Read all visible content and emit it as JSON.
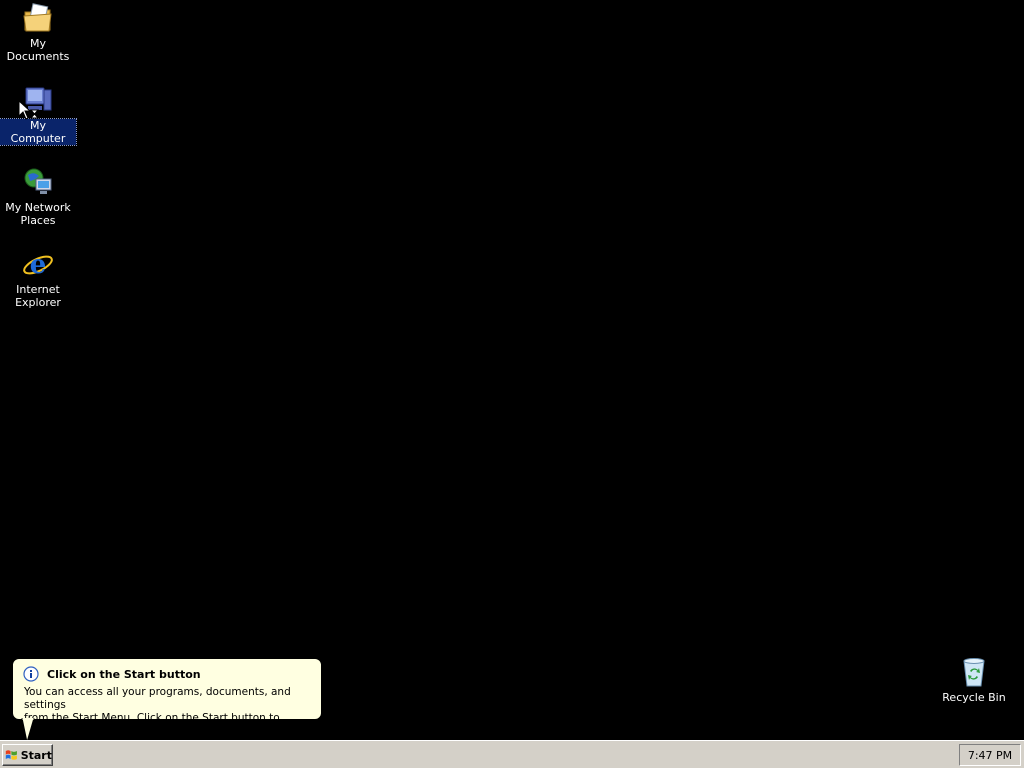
{
  "desktop": {
    "icons": [
      {
        "label": "My Documents",
        "icon": "my-documents-icon"
      },
      {
        "label": "My Computer",
        "icon": "my-computer-icon",
        "selected": true
      },
      {
        "label": "My Network Places",
        "icon": "my-network-places-icon"
      },
      {
        "label": "Internet Explorer",
        "icon": "internet-explorer-icon"
      },
      {
        "label": "Recycle Bin",
        "icon": "recycle-bin-icon"
      }
    ],
    "background": "#000000",
    "selection_color": "#0a246a"
  },
  "balloon": {
    "title": "Click on the Start button",
    "body_line1": "You can access all your programs, documents, and settings",
    "body_line2": "from the Start Menu. Click on the Start button to begin.",
    "icon": "info-icon",
    "background": "#ffffe1"
  },
  "taskbar": {
    "start_label": "Start",
    "clock": "7:47 PM",
    "background": "#d4d0c8"
  }
}
